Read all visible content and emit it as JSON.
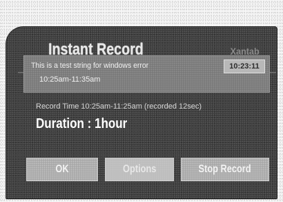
{
  "dialog": {
    "title": "Instant Record",
    "brand": "Xantab"
  },
  "program": {
    "line1": "This is a test string for windows error",
    "line2": "10:25am-11:35am",
    "channel": "10:23:11"
  },
  "record": {
    "time_text": "Record Time 10:25am-11:25am (recorded 12sec)",
    "duration_text": "Duration : 1hour"
  },
  "buttons": {
    "ok": "OK",
    "options": "Options",
    "stop": "Stop Record"
  }
}
